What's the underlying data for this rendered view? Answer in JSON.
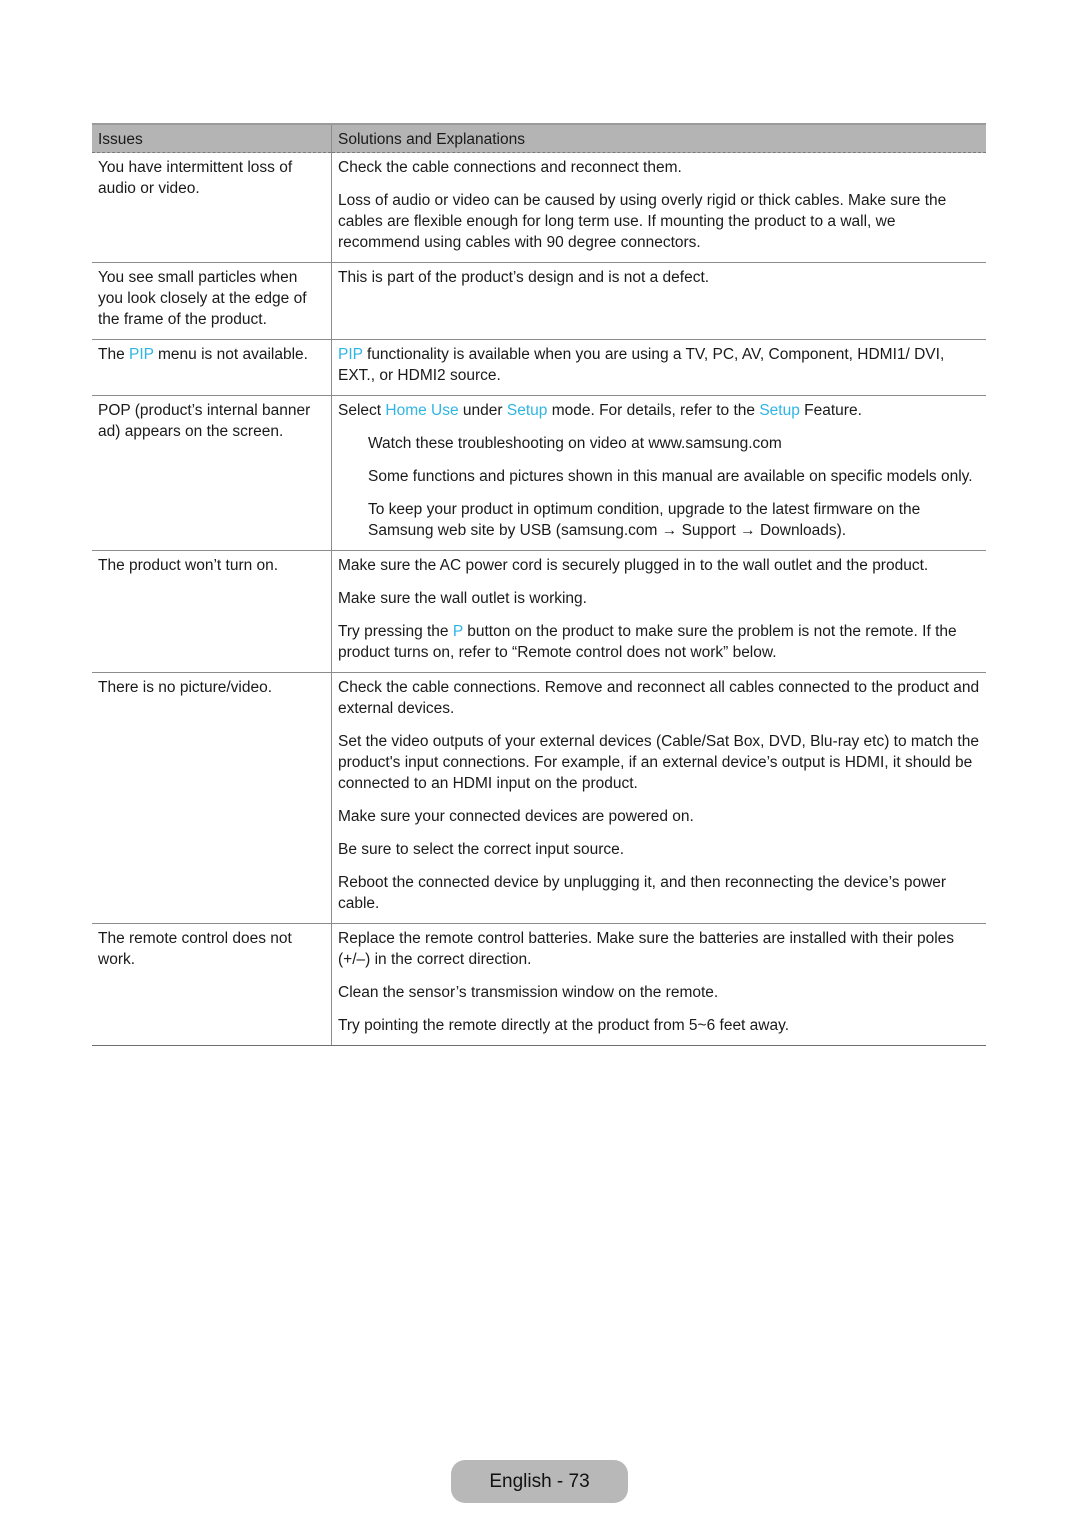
{
  "table": {
    "headers": {
      "issues": "Issues",
      "solutions": "Solutions and Explanations"
    },
    "rows": [
      {
        "issue": "You have intermittent loss of audio or video.",
        "solutions": [
          "Check the cable connections and reconnect them.",
          "Loss of audio or video can be caused by using overly rigid or thick cables. Make sure the cables are flexible enough for long term use. If mounting the product to a wall, we recommend using cables with 90 degree connectors."
        ]
      },
      {
        "issue": "You see small particles when you look closely at the edge of the frame of the product.",
        "solutions": [
          "This is part of the product’s design and is not a defect."
        ]
      },
      {
        "issue_parts": {
          "a": "The ",
          "b": "PIP",
          "c": " menu is not available."
        },
        "solution_parts": {
          "a": "PIP",
          "b": " functionality is available when you are using a TV, PC, AV, Component, HDMI1/ DVI, EXT., or HDMI2 source."
        }
      },
      {
        "issue": "POP (product’s internal banner ad) appears on the screen.",
        "solution_parts": {
          "a": "Select ",
          "b": "Home Use",
          "c": " under ",
          "d": "Setup",
          "e": " mode. For details, refer to the ",
          "f": "Setup",
          "g": " Feature."
        },
        "notes": [
          "Watch these troubleshooting on video at www.samsung.com",
          "Some functions and pictures shown in this manual are available on specific models only.",
          "To keep your product in optimum condition, upgrade to the latest firmware on the Samsung web site by USB (samsung.com → Support → Downloads)."
        ]
      },
      {
        "issue": "The product won’t turn on.",
        "solutions": [
          "Make sure the AC power cord is securely plugged in to the wall outlet and the product.",
          "Make sure the wall outlet is working."
        ],
        "solution_parts": {
          "a": "Try pressing the ",
          "b": "P",
          "c": " button on the product to make sure the problem is not the remote. If the product turns on, refer to “Remote control does not work” below."
        }
      },
      {
        "issue": "There is no picture/video.",
        "solutions": [
          "Check the cable connections. Remove and reconnect all cables connected to the product and external devices.",
          "Set the video outputs of your external devices (Cable/Sat Box, DVD, Blu-ray etc) to match the product's input connections. For example, if an external device’s output is HDMI, it should be connected to an HDMI input on the product.",
          "Make sure your connected devices are powered on.",
          "Be sure to select the correct input source.",
          "Reboot the connected device by unplugging it, and then reconnecting the device’s power cable."
        ]
      },
      {
        "issue": "The remote control does not work.",
        "solutions": [
          "Replace the remote control batteries. Make sure the batteries are installed with their poles (+/–) in the correct direction.",
          "Clean the sensor’s transmission window on the remote.",
          "Try pointing the remote directly at the product from 5~6 feet away."
        ]
      }
    ]
  },
  "highlight_color": "#2fb4e4",
  "footer": {
    "page_label": "English - 73"
  }
}
